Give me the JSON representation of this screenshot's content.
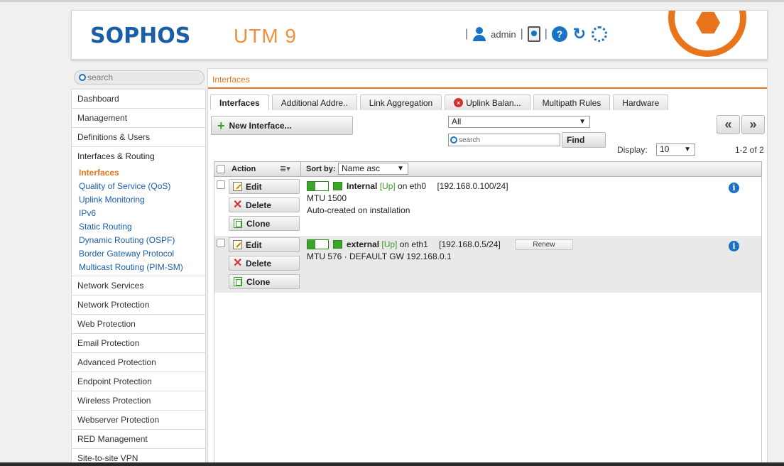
{
  "header": {
    "logo": "SOPHOS",
    "product": "UTM 9",
    "user": "admin",
    "separator": "|"
  },
  "sidebar": {
    "search_placeholder": "search",
    "items": [
      {
        "label": "Dashboard"
      },
      {
        "label": "Management"
      },
      {
        "label": "Definitions & Users"
      },
      {
        "label": "Interfaces & Routing"
      },
      {
        "label": "Network Services"
      },
      {
        "label": "Network Protection"
      },
      {
        "label": "Web Protection"
      },
      {
        "label": "Email Protection"
      },
      {
        "label": "Advanced Protection"
      },
      {
        "label": "Endpoint Protection"
      },
      {
        "label": "Wireless Protection"
      },
      {
        "label": "Webserver Protection"
      },
      {
        "label": "RED Management"
      },
      {
        "label": "Site-to-site VPN"
      }
    ],
    "subitems": [
      {
        "label": "Interfaces"
      },
      {
        "label": "Quality of Service (QoS)"
      },
      {
        "label": "Uplink Monitoring"
      },
      {
        "label": "IPv6"
      },
      {
        "label": "Static Routing"
      },
      {
        "label": "Dynamic Routing (OSPF)"
      },
      {
        "label": "Border Gateway Protocol"
      },
      {
        "label": "Multicast Routing (PIM-SM)"
      }
    ]
  },
  "breadcrumb": "Interfaces",
  "tabs": [
    {
      "label": "Interfaces"
    },
    {
      "label": "Additional Addre.."
    },
    {
      "label": "Link Aggregation"
    },
    {
      "label": "Uplink Balan..."
    },
    {
      "label": "Multipath Rules"
    },
    {
      "label": "Hardware"
    }
  ],
  "toolbar": {
    "new_interface": "New Interface...",
    "filter_value": "All",
    "search_placeholder": "search",
    "find": "Find",
    "display_label": "Display:",
    "display_value": "10",
    "range": "1-2 of 2",
    "first_page": "«",
    "last_page": "»"
  },
  "list": {
    "action_header": "Action",
    "sort_label": "Sort by:",
    "sort_value": "Name asc",
    "edit": "Edit",
    "delete": "Delete",
    "clone": "Clone",
    "renew": "Renew",
    "rows": [
      {
        "name": "Internal",
        "status": "[Up]",
        "on": "on eth0",
        "address": "[192.168.0.100/24]",
        "line2": "MTU 1500",
        "line3": "Auto-created on installation"
      },
      {
        "name": "external",
        "status": "[Up]",
        "on": "on eth1",
        "address": "[192.168.0.5/24]",
        "line2": "MTU 576 · DEFAULT GW 192.168.0.1",
        "line3": ""
      }
    ]
  },
  "colors": {
    "brand_blue": "#1a5ea8",
    "accent_orange": "#e8751c",
    "status_green": "#3a9a2a"
  }
}
